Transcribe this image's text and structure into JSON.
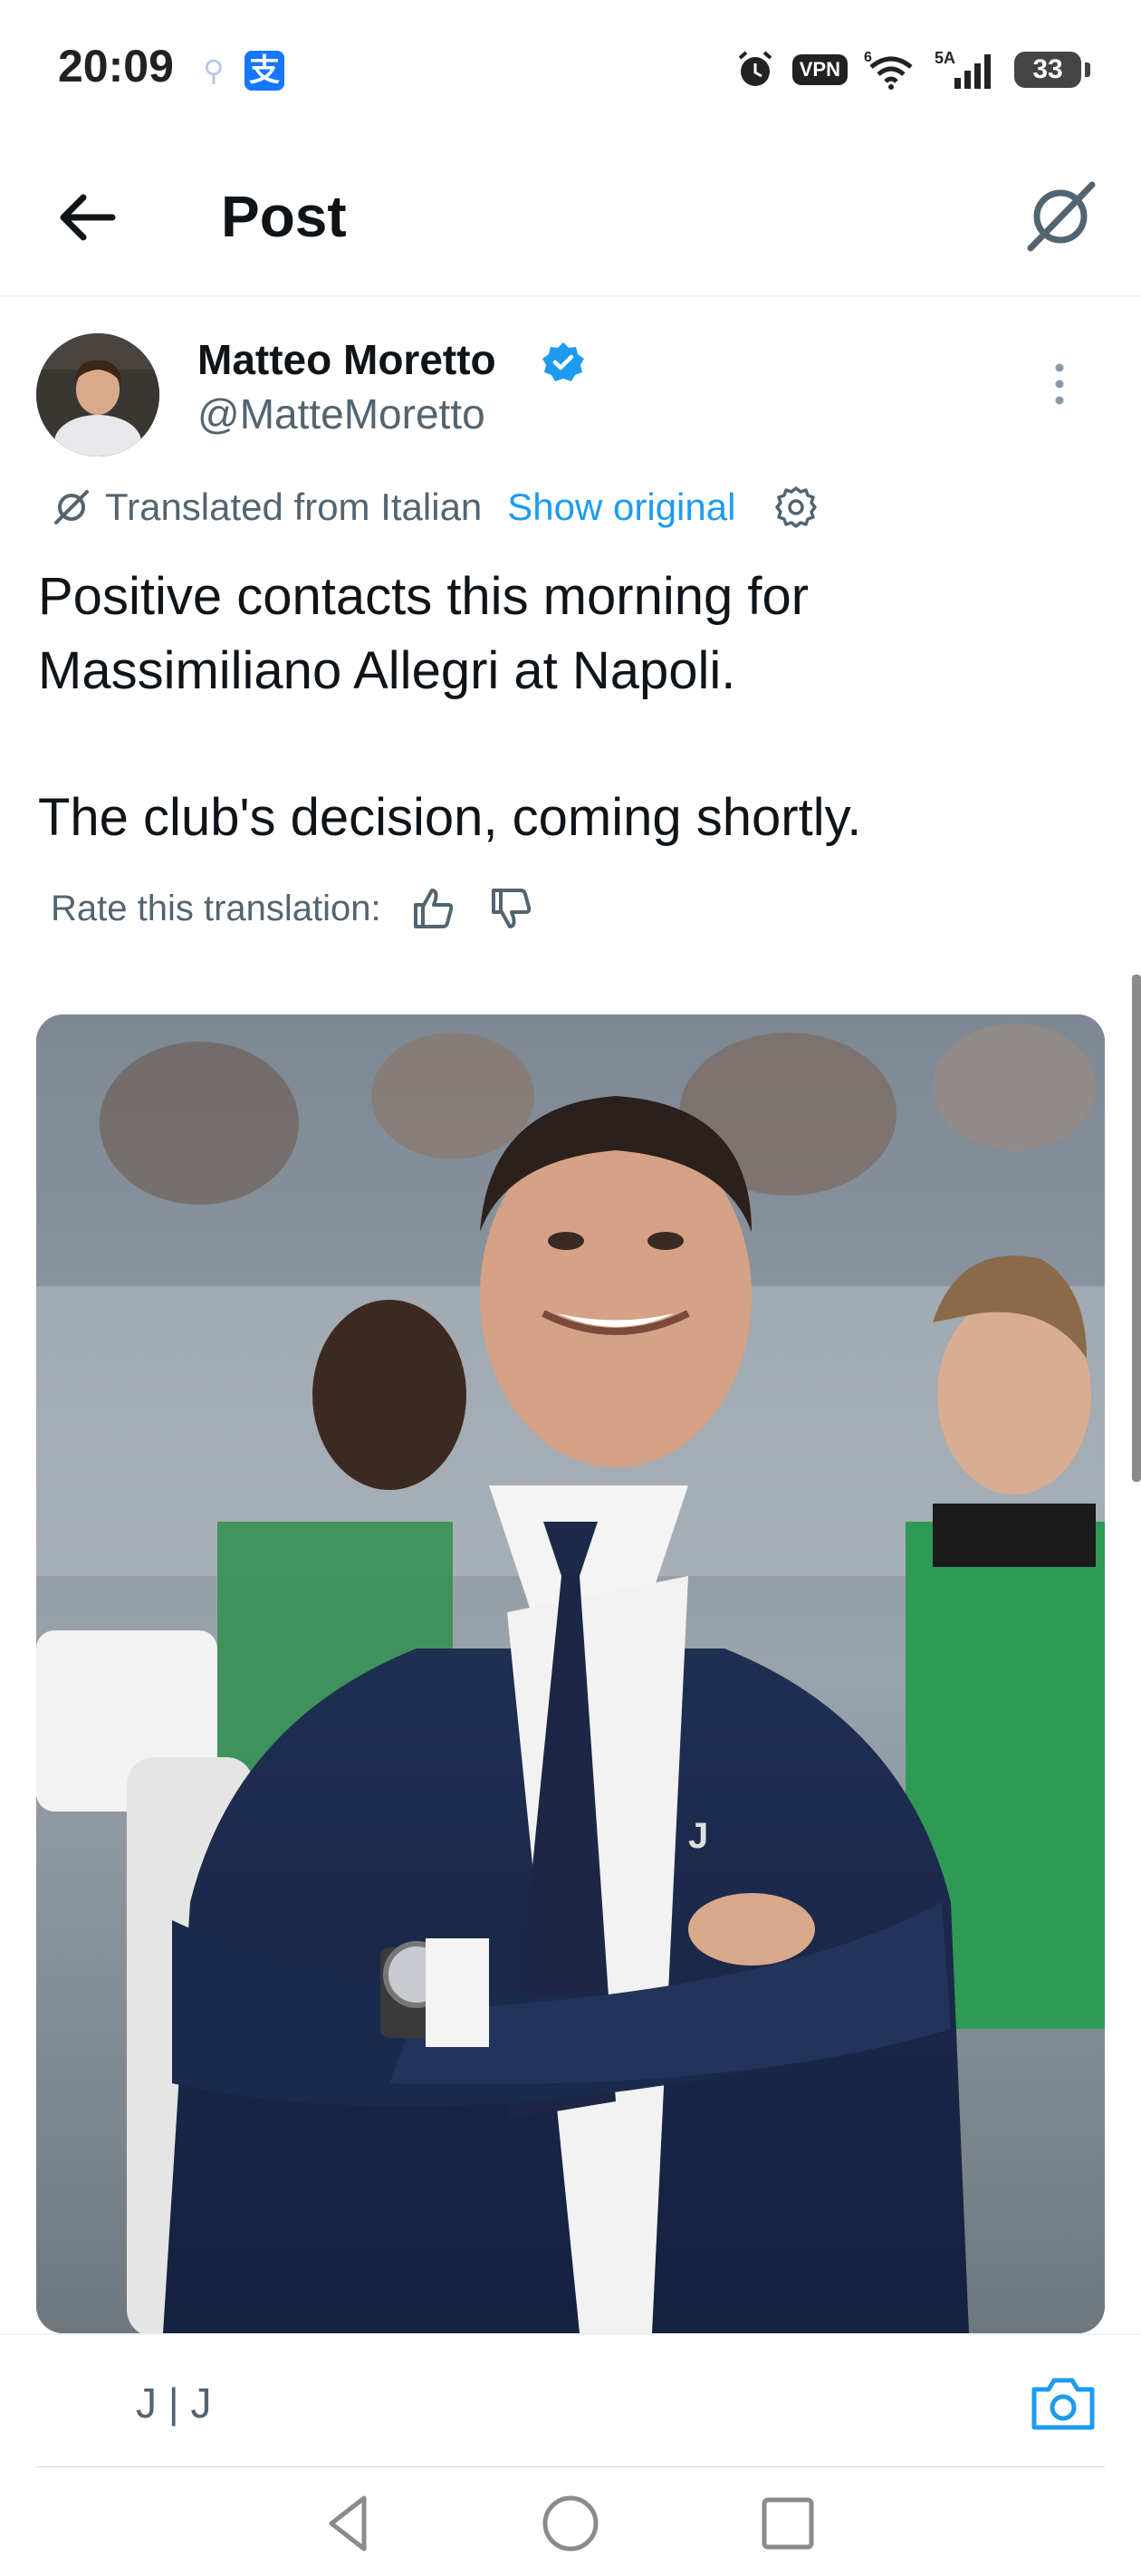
{
  "status_bar": {
    "time": "20:09",
    "app_icon": "支",
    "vpn": "VPN",
    "network": "5A",
    "wifi_index": "6",
    "battery": "33"
  },
  "header": {
    "title": "Post",
    "back_icon": "arrow-left-icon",
    "grok_icon": "grok-icon"
  },
  "tweet": {
    "author_name": "Matteo Moretto",
    "author_handle": "@MatteMoretto",
    "translated_label": "Translated from Italian",
    "show_original": "Show original",
    "text_line1": "Positive contacts this morning for Massimiliano Allegri at Napoli.",
    "text_line2": "The club's decision, coming shortly.",
    "rate_label": "Rate this translation:",
    "media_alt": "Photo of Massimiliano Allegri smiling with arms crossed in a stadium dugout"
  },
  "composer": {
    "placeholder": "J | J"
  },
  "colors": {
    "accent": "#1d9bf0",
    "text": "#0f1419",
    "muted": "#536471"
  }
}
